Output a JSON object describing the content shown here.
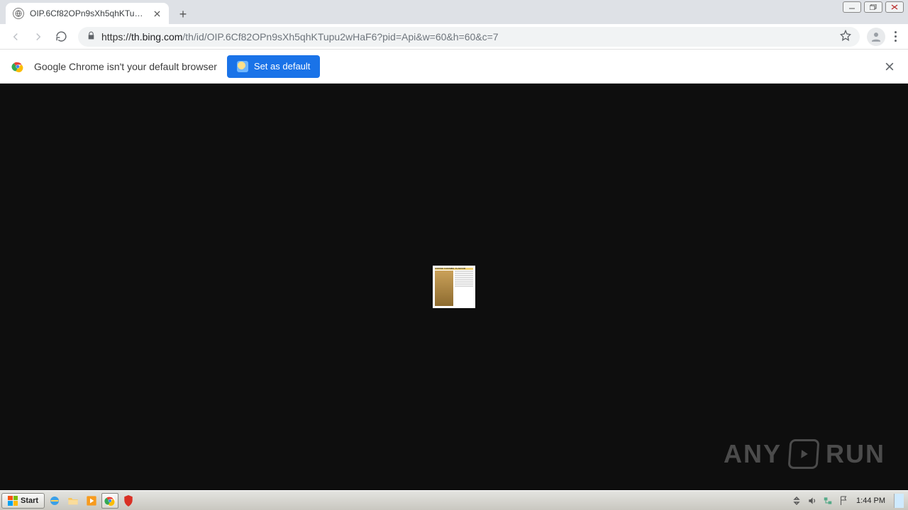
{
  "tab": {
    "title": "OIP.6Cf82OPn9sXh5qhKTupu2wHaF..."
  },
  "url": {
    "host": "th.bing.com",
    "path": "/th/id/OIP.6Cf82OPn9sXh5qhKTupu2wHaF6?pid=Api&w=60&h=60&c=7"
  },
  "infobar": {
    "message": "Google Chrome isn't your default browser",
    "button": "Set as default"
  },
  "watermark": {
    "left": "ANY",
    "right": "RUN"
  },
  "taskbar": {
    "start": "Start",
    "time": "1:44 PM"
  }
}
